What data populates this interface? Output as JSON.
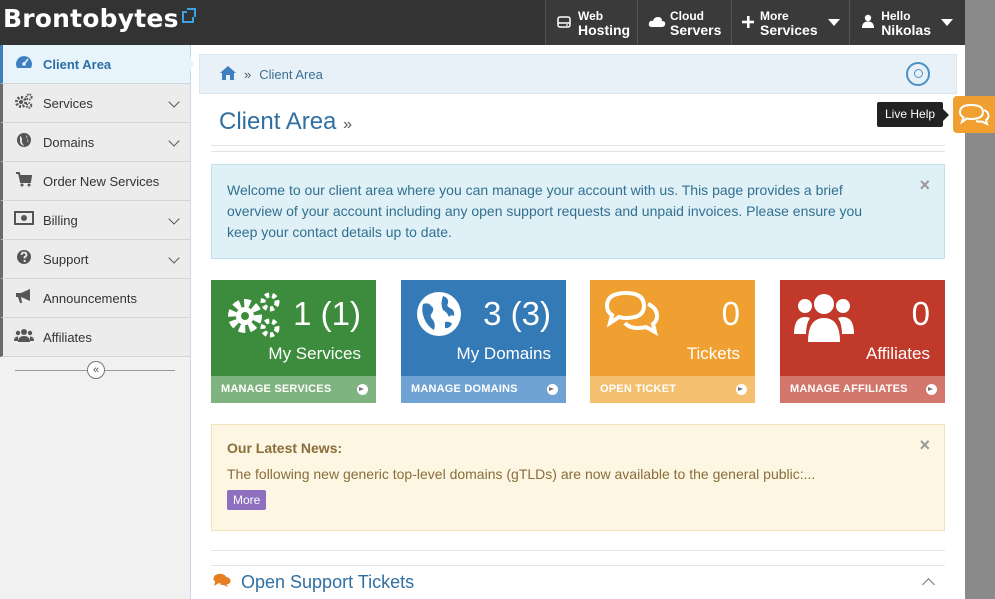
{
  "header": {
    "logo": "Brontobytes",
    "nav": [
      {
        "top": "Web",
        "bottom": "Hosting",
        "icon": "server-icon"
      },
      {
        "top": "Cloud",
        "bottom": "Servers",
        "icon": "cloud-icon"
      },
      {
        "top": "More",
        "bottom": "Services",
        "icon": "plus-icon"
      },
      {
        "top": "Hello",
        "bottom": "Nikolas",
        "icon": "user-icon"
      }
    ]
  },
  "sidebar": {
    "items": [
      {
        "label": "Client Area",
        "icon": "dashboard-icon"
      },
      {
        "label": "Services",
        "icon": "gears-icon"
      },
      {
        "label": "Domains",
        "icon": "globe-icon"
      },
      {
        "label": "Order New Services",
        "icon": "cart-icon"
      },
      {
        "label": "Billing",
        "icon": "money-icon"
      },
      {
        "label": "Support",
        "icon": "question-icon"
      },
      {
        "label": "Announcements",
        "icon": "megaphone-icon"
      },
      {
        "label": "Affiliates",
        "icon": "users-icon"
      }
    ],
    "collapse_glyph": "«"
  },
  "breadcrumb": {
    "separator": "»",
    "current": "Client Area"
  },
  "page": {
    "title": "Client Area",
    "title_suffix": "»"
  },
  "welcome": {
    "text": "Welcome to our client area where you can manage your account with us. This page provides a brief overview of your account including any open support requests and unpaid invoices. Please ensure you keep your contact details up to date.",
    "close": "×"
  },
  "tiles": [
    {
      "count": "1 (1)",
      "caption": "My Services",
      "action": "MANAGE SERVICES",
      "color": "#3d8b3d",
      "footer_color": "#7fb37f",
      "icon": "gears-icon"
    },
    {
      "count": "3 (3)",
      "caption": "My Domains",
      "action": "MANAGE DOMAINS",
      "color": "#337ab7",
      "footer_color": "#6fa3d3",
      "icon": "globe-icon"
    },
    {
      "count": "0",
      "caption": "Tickets",
      "action": "OPEN TICKET",
      "color": "#efa030",
      "footer_color": "#f4c06f",
      "icon": "comments-icon"
    },
    {
      "count": "0",
      "caption": "Affiliates",
      "action": "MANAGE AFFILIATES",
      "color": "#c0392b",
      "footer_color": "#d3766c",
      "icon": "users-icon"
    }
  ],
  "news": {
    "title": "Our Latest News:",
    "text": "The following new generic top-level domains (gTLDs) are now available to the general public:...",
    "more": "More",
    "close": "×"
  },
  "tickets_panel": {
    "title": "Open Support Tickets"
  },
  "live_help": {
    "label": "Live Help"
  }
}
